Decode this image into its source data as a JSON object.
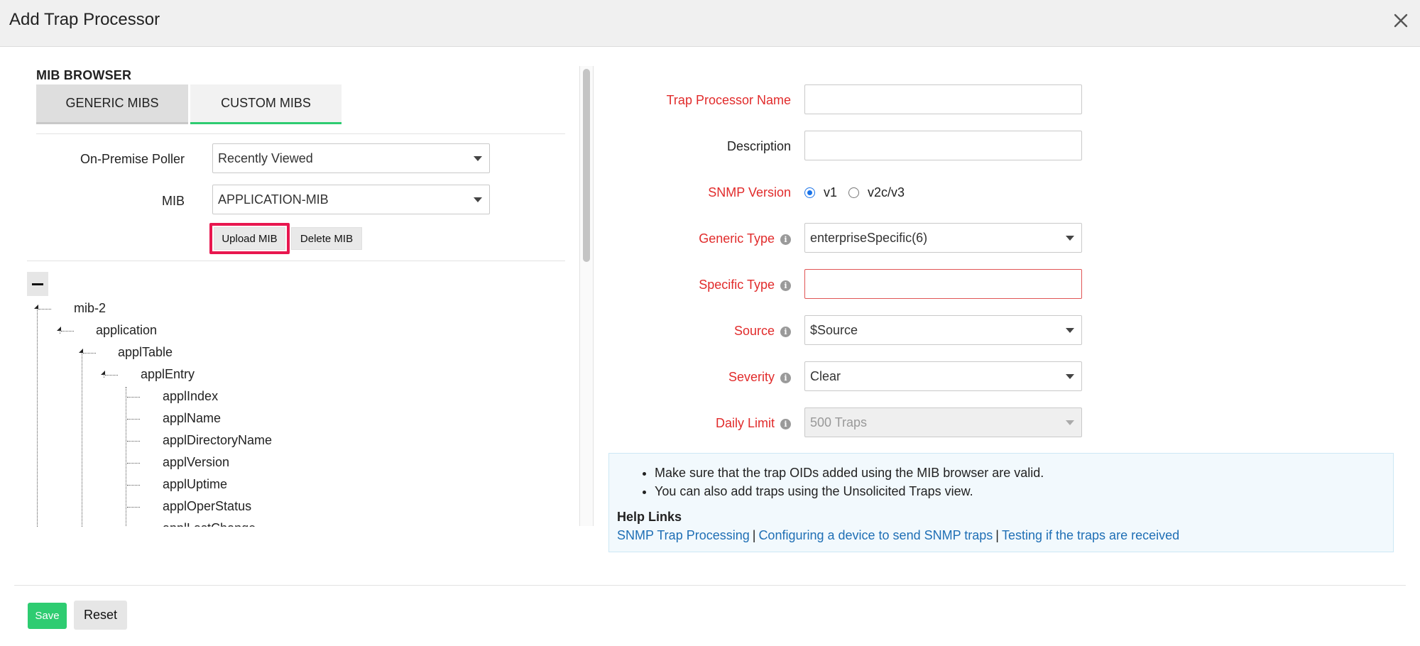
{
  "header": {
    "title": "Add Trap Processor",
    "close_icon": "close-icon"
  },
  "mib_browser": {
    "title": "MIB BROWSER",
    "tabs": [
      {
        "label": "GENERIC MIBS",
        "active": false
      },
      {
        "label": "CUSTOM MIBS",
        "active": true
      }
    ],
    "poller": {
      "label": "On-Premise Poller",
      "value": "Recently Viewed"
    },
    "mib": {
      "label": "MIB",
      "value": "APPLICATION-MIB"
    },
    "upload_label": "Upload MIB",
    "delete_label": "Delete MIB",
    "tree": {
      "root": "mib-2",
      "level1": "application",
      "level2": "applTable",
      "level3": "applEntry",
      "leaves": [
        "applIndex",
        "applName",
        "applDirectoryName",
        "applVersion",
        "applUptime",
        "applOperStatus",
        "applLastChange"
      ]
    }
  },
  "form": {
    "trap_name": {
      "label": "Trap Processor Name",
      "value": ""
    },
    "description": {
      "label": "Description",
      "value": ""
    },
    "snmp_version": {
      "label": "SNMP Version",
      "options": [
        "v1",
        "v2c/v3"
      ],
      "selected": "v1"
    },
    "generic_type": {
      "label": "Generic Type",
      "value": "enterpriseSpecific(6)"
    },
    "specific_type": {
      "label": "Specific Type",
      "value": ""
    },
    "source": {
      "label": "Source",
      "value": "$Source"
    },
    "severity": {
      "label": "Severity",
      "value": "Clear"
    },
    "daily_limit": {
      "label": "Daily Limit",
      "value": "500 Traps"
    }
  },
  "notes": {
    "bullets": [
      "Make sure that the trap OIDs added using the MIB browser are valid.",
      "You can also add traps using the Unsolicited Traps view."
    ],
    "help_title": "Help Links",
    "links": [
      "SNMP Trap Processing",
      "Configuring a device to send SNMP traps",
      "Testing if the traps are received"
    ],
    "separator": "|"
  },
  "footer": {
    "save_label": "Save",
    "reset_label": "Reset"
  },
  "colors": {
    "required": "#e12b2b",
    "accent_green": "#2ecc71",
    "link": "#1f6fb5",
    "highlight": "#e8174f"
  }
}
